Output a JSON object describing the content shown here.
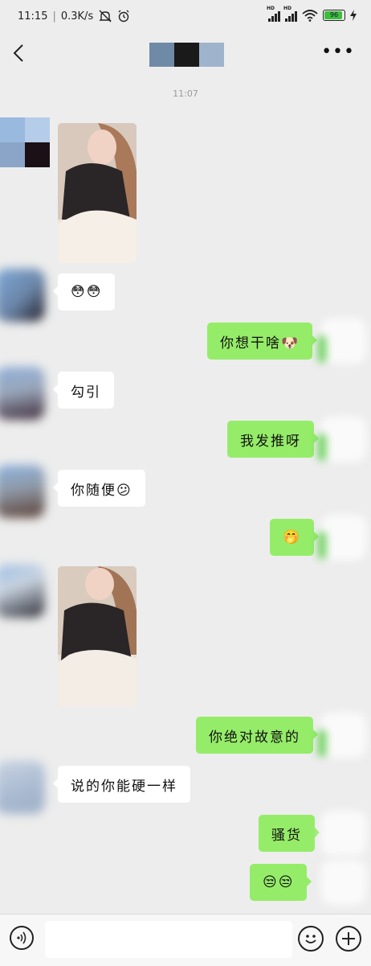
{
  "status_bar": {
    "time": "11:15",
    "speed": "0.3K/s",
    "battery": "96"
  },
  "chat": {
    "timestamp": "11:07",
    "messages": [
      {
        "from": "other",
        "type": "image"
      },
      {
        "from": "other",
        "type": "emoji",
        "text": "😳😳"
      },
      {
        "from": "me",
        "text": "你想干啥🐶"
      },
      {
        "from": "other",
        "text": "勾引"
      },
      {
        "from": "me",
        "text": "我发推呀"
      },
      {
        "from": "other",
        "text": "你随便😕"
      },
      {
        "from": "me",
        "type": "emoji",
        "text": "🤭"
      },
      {
        "from": "other",
        "type": "image"
      },
      {
        "from": "me",
        "text": "你绝对故意的"
      },
      {
        "from": "other",
        "text": "说的你能硬一样"
      },
      {
        "from": "me",
        "text": "骚货"
      },
      {
        "from": "me",
        "type": "emoji",
        "text": "😒😒"
      }
    ]
  },
  "colors": {
    "outgoing_bubble": "#95ec69",
    "incoming_bubble": "#ffffff",
    "background": "#ededed"
  },
  "icons": {
    "back": "chevron-left-icon",
    "more": "more-dots-icon",
    "voice": "voice-icon",
    "emoji": "emoji-icon",
    "plus": "plus-icon"
  },
  "input": {
    "value": ""
  }
}
